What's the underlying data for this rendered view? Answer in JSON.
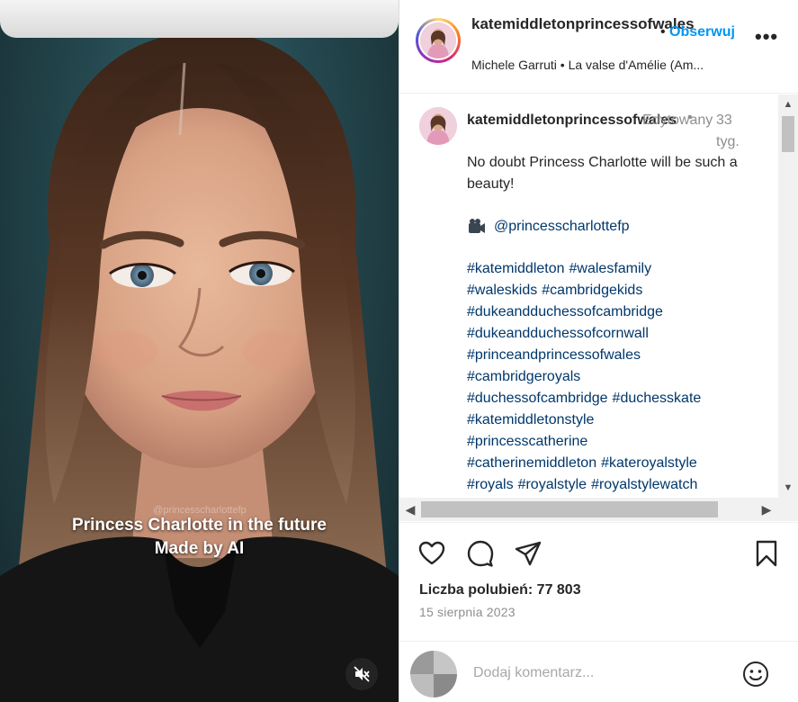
{
  "media": {
    "watermark": "@princesscharlottefp",
    "caption_line1": "Princess Charlotte in the future",
    "caption_line2": "Made by AI"
  },
  "header": {
    "username": "katemiddletonprincessofwales",
    "follow_label": "Obserwuj",
    "separator": "•",
    "more_label": "•••",
    "audio": "Michele Garruti • La valse d'Amélie (Am..."
  },
  "comment": {
    "username": "katemiddletonprincessofwales",
    "edited_label": "Edytowany",
    "separator": "•",
    "time": "33 tyg.",
    "body": "No doubt Princess Charlotte will be such a beauty!",
    "mention": "@princesscharlottefp",
    "hashtags": [
      "#katemiddleton",
      "#walesfamily",
      "#waleskids",
      "#cambridgekids",
      "#dukeandduchessofcambridge",
      "#dukeandduchessofcornwall",
      "#princeandprincessofwales",
      "#cambridgeroyals",
      "#duchessofcambridge",
      "#duchesskate",
      "#katemiddletonstyle",
      "#princesscatherine",
      "#catherinemiddleton",
      "#kateroyalstyle",
      "#royals",
      "#royalstyle",
      "#royalstylewatch"
    ]
  },
  "stats": {
    "likes": "Liczba polubień: 77 803",
    "date": "15 sierpnia 2023"
  },
  "add_comment": {
    "placeholder": "Dodaj komentarz..."
  },
  "icons": {
    "like": "heart-icon",
    "comment": "comment-icon",
    "share": "send-icon",
    "save": "bookmark-icon",
    "emoji": "smiley-icon",
    "mute": "speaker-muted-icon",
    "mention_camera": "camera-icon"
  },
  "colors": {
    "follow": "#0095f6",
    "link": "#00376b",
    "muted_text": "#8e8e8e"
  }
}
